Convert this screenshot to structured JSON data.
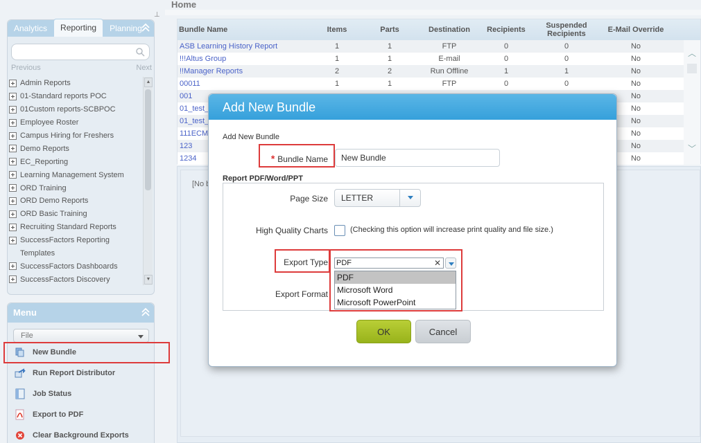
{
  "page": {
    "title": "Home"
  },
  "sidebar": {
    "tabs": [
      {
        "label": "Analytics"
      },
      {
        "label": "Reporting"
      },
      {
        "label": "Planning"
      }
    ],
    "pager": {
      "previous": "Previous",
      "next": "Next"
    },
    "reports": [
      "Admin Reports",
      "01-Standard reports POC",
      "01Custom reports-SCBPOC",
      "Employee Roster",
      "Campus Hiring for Freshers",
      "Demo Reports",
      "EC_Reporting",
      "Learning Management System",
      "ORD Training",
      "ORD Demo Reports",
      "ORD Basic Training",
      "Recruiting Standard Reports",
      "SuccessFactors Reporting",
      "Templates",
      "SuccessFactors Dashboards",
      "SuccessFactors Discovery"
    ]
  },
  "menu": {
    "title": "Menu",
    "file_select": "File",
    "items": [
      {
        "label": "New Bundle",
        "icon": "new-bundle-icon"
      },
      {
        "label": "Run Report Distributor",
        "icon": "run-distributor-icon"
      },
      {
        "label": "Job Status",
        "icon": "job-status-icon"
      },
      {
        "label": "Export to PDF",
        "icon": "pdf-icon"
      },
      {
        "label": "Clear Background Exports",
        "icon": "clear-icon"
      }
    ]
  },
  "grid": {
    "headers": {
      "name": "Bundle Name",
      "items": "Items",
      "parts": "Parts",
      "destination": "Destination",
      "recipients": "Recipients",
      "suspended_1": "Suspended",
      "suspended_2": "Recipients",
      "email": "E-Mail Override"
    },
    "rows": [
      [
        "ASB Learning History Report",
        "1",
        "1",
        "FTP",
        "0",
        "0",
        "No"
      ],
      [
        "!!!Altus Group",
        "1",
        "1",
        "E-mail",
        "0",
        "0",
        "No"
      ],
      [
        "!!Manager Reports",
        "2",
        "2",
        "Run Offline",
        "1",
        "1",
        "No"
      ],
      [
        "00011",
        "1",
        "1",
        "FTP",
        "0",
        "0",
        "No"
      ],
      [
        "001",
        "",
        "",
        "",
        "",
        "",
        "No"
      ],
      [
        "01_test_",
        "",
        "",
        "",
        "",
        "",
        "No"
      ],
      [
        "01_test_",
        "",
        "",
        "",
        "",
        "",
        "No"
      ],
      [
        "111ECM",
        "",
        "",
        "",
        "",
        "",
        "No"
      ],
      [
        "123",
        "",
        "",
        "",
        "",
        "",
        "No"
      ],
      [
        "1234",
        "",
        "",
        "",
        "",
        "",
        "No"
      ]
    ]
  },
  "detail": {
    "empty_text": "[No b"
  },
  "dialog": {
    "title": "Add New Bundle",
    "subtitle": "Add New Bundle",
    "required_mark": "*",
    "bundle_name_label": "Bundle Name",
    "bundle_name_value": "New Bundle",
    "section_label": "Report PDF/Word/PPT",
    "page_size_label": "Page Size",
    "page_size_value": "LETTER",
    "hq_charts_label": "High Quality Charts",
    "hq_charts_note": "(Checking this option will increase print quality and file size.)",
    "hq_charts_checked": false,
    "export_type_label": "Export Type",
    "export_type_value": "PDF",
    "export_type_options": [
      "PDF",
      "Microsoft Word",
      "Microsoft PowerPoint"
    ],
    "export_format_label": "Export Format",
    "ok_label": "OK",
    "cancel_label": "Cancel"
  },
  "colors": {
    "accent": "#3aa3dc",
    "highlight": "#dd3b3b",
    "ok_button": "#a8c128",
    "link": "#4a62c8"
  }
}
